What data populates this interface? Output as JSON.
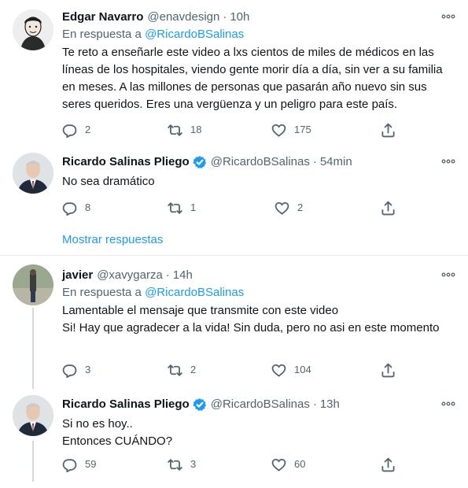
{
  "colors": {
    "accent": "#1d9bf0",
    "secondary_text": "#536471",
    "line": "#cfd9de"
  },
  "tweets": [
    {
      "name": "Edgar Navarro",
      "handle": "@enavdesign",
      "sep": "·",
      "time": "10h",
      "replying_prefix": "En respuesta a",
      "replying_to": "@RicardoBSalinas",
      "text": "Te reto a enseñarle este video a lxs cientos de miles de médicos en las líneas de los hospitales, viendo gente morir día a día, sin ver a su familia en meses. A las millones de personas que pasarán año nuevo sin sus seres queridos. Eres una vergüenza y un peligro para este país.",
      "replies": "2",
      "retweets": "18",
      "likes": "175"
    },
    {
      "name": "Ricardo Salinas Pliego",
      "handle": "@RicardoBSalinas",
      "sep": "·",
      "time": "54min",
      "text": "No sea dramático",
      "replies": "8",
      "retweets": "1",
      "likes": "2"
    },
    {
      "name": "javier",
      "handle": "@xavygarza",
      "sep": "·",
      "time": "14h",
      "replying_prefix": "En respuesta a",
      "replying_to": "@RicardoBSalinas",
      "text": "Lamentable el mensaje que transmite con este video\nSi! Hay que agradecer a la vida! Sin duda, pero no asi en este momento",
      "replies": "3",
      "retweets": "2",
      "likes": "104"
    },
    {
      "name": "Ricardo Salinas Pliego",
      "handle": "@RicardoBSalinas",
      "sep": "·",
      "time": "13h",
      "text": "Si no es hoy..\nEntonces CUÁNDO?",
      "replies": "59",
      "retweets": "3",
      "likes": "60"
    }
  ],
  "show_replies": "Mostrar respuestas"
}
